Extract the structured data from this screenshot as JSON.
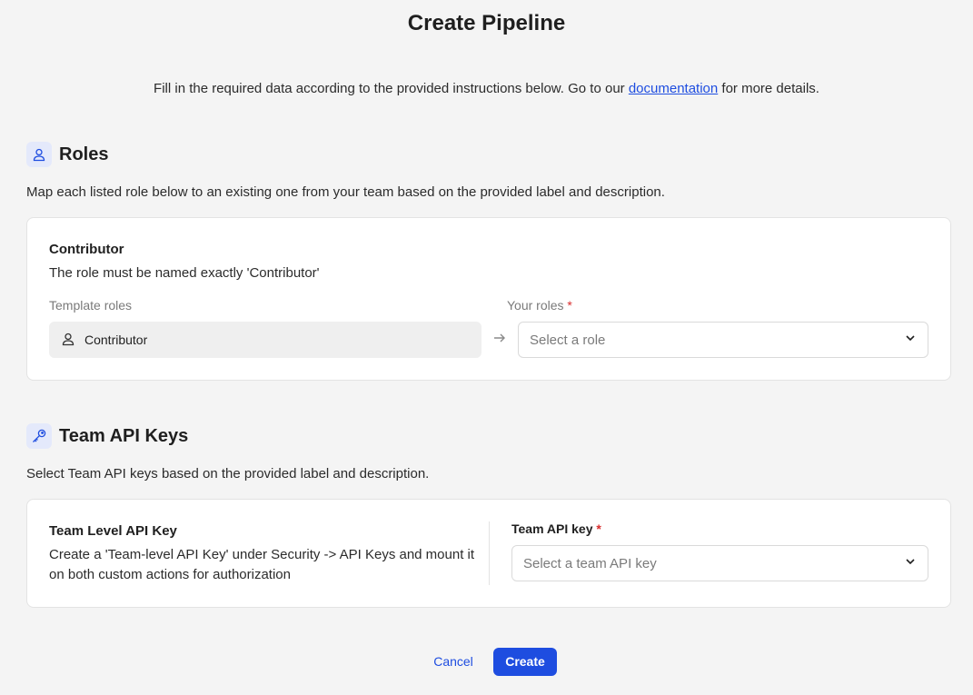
{
  "page": {
    "title": "Create Pipeline",
    "intro_before": "Fill in the required data according to the provided instructions below. Go to our ",
    "intro_link": "documentation",
    "intro_after": " for more details."
  },
  "roles": {
    "heading": "Roles",
    "description": "Map each listed role below to an existing one from your team based on the provided label and description.",
    "item": {
      "title": "Contributor",
      "description": "The role must be named exactly 'Contributor'",
      "template_label": "Template roles",
      "template_value": "Contributor",
      "your_label": "Your roles",
      "required_mark": "*",
      "placeholder": "Select a role"
    }
  },
  "keys": {
    "heading": "Team API Keys",
    "description": "Select Team API keys based on the provided label and description.",
    "item": {
      "title": "Team Level API Key",
      "description": "Create a 'Team-level API Key' under Security -> API Keys and mount it on both custom actions for authorization",
      "field_label": "Team API key",
      "required_mark": "*",
      "placeholder": "Select a team API key"
    }
  },
  "footer": {
    "cancel_label": "Cancel",
    "create_label": "Create"
  },
  "colors": {
    "accent": "#1e4de0",
    "required": "#d92d2d",
    "background": "#f4f4f4"
  },
  "icons": {
    "roles_section": "user-icon",
    "keys_section": "key-icon",
    "template_role": "user-icon",
    "arrow": "arrow-right-icon",
    "select": "chevron-down-icon"
  }
}
